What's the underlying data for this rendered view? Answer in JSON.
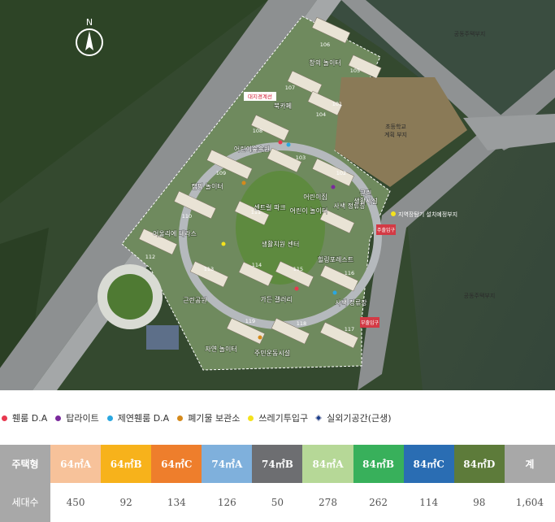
{
  "map": {
    "north": "N",
    "areas": {
      "public_housing_top": "공동주택부지",
      "public_housing_right": "공동주택부지",
      "school": [
        "초등학교",
        "계획 부지"
      ],
      "boundary": "대지경계선",
      "ev_charger": "지역장탐기 설치예정부지",
      "main_gate": "주출입구",
      "sub_gate": "부출입구",
      "park": "근린공원",
      "facility": [
        "근린",
        "생활시설"
      ]
    },
    "facilities": [
      "창의 놀이터",
      "북카페",
      "어린이숲속원",
      "캠핑 놀이터",
      "어울리에 테라스",
      "센트럴 파크",
      "생활치원 센터",
      "어린이집",
      "어린이 놀이터",
      "사색 정류장",
      "힐링포레스트",
      "가든 갤러리",
      "사색 정류장",
      "자연 놀이터",
      "주민운동시설"
    ],
    "buildings": [
      "101",
      "102",
      "103",
      "104",
      "105",
      "106",
      "107",
      "108",
      "109",
      "110",
      "111",
      "112",
      "113",
      "114",
      "115",
      "116",
      "117",
      "118",
      "119"
    ]
  },
  "legend": [
    {
      "label": "휀룸 D.A",
      "color": "#e8384f",
      "shape": "dot"
    },
    {
      "label": "탑라이트",
      "color": "#7a2a9c",
      "shape": "dot"
    },
    {
      "label": "제연휀룸 D.A",
      "color": "#2aa7e0",
      "shape": "dot"
    },
    {
      "label": "폐기물 보관소",
      "color": "#d58a1c",
      "shape": "dot"
    },
    {
      "label": "쓰레기투입구",
      "color": "#f4e21d",
      "shape": "dot"
    },
    {
      "label": "실외기공간(근생)",
      "color": "#1a3e8c",
      "shape": "diamond"
    }
  ],
  "table": {
    "header_label": "주택형",
    "row_label": "세대수",
    "columns": [
      {
        "type": "64㎡A",
        "count": "450",
        "color": "#f7c29a"
      },
      {
        "type": "64㎡B",
        "count": "92",
        "color": "#f7b21b"
      },
      {
        "type": "64㎡C",
        "count": "134",
        "color": "#ee7e2c"
      },
      {
        "type": "74㎡A",
        "count": "126",
        "color": "#7fb0dc"
      },
      {
        "type": "74㎡B",
        "count": "50",
        "color": "#6d6e71"
      },
      {
        "type": "84㎡A",
        "count": "278",
        "color": "#b6d897"
      },
      {
        "type": "84㎡B",
        "count": "262",
        "color": "#38b05b"
      },
      {
        "type": "84㎡C",
        "count": "114",
        "color": "#2a6db3"
      },
      {
        "type": "84㎡D",
        "count": "98",
        "color": "#5d7b3a"
      },
      {
        "type": "계",
        "count": "1,604",
        "color": "#a8a8a8"
      }
    ]
  }
}
